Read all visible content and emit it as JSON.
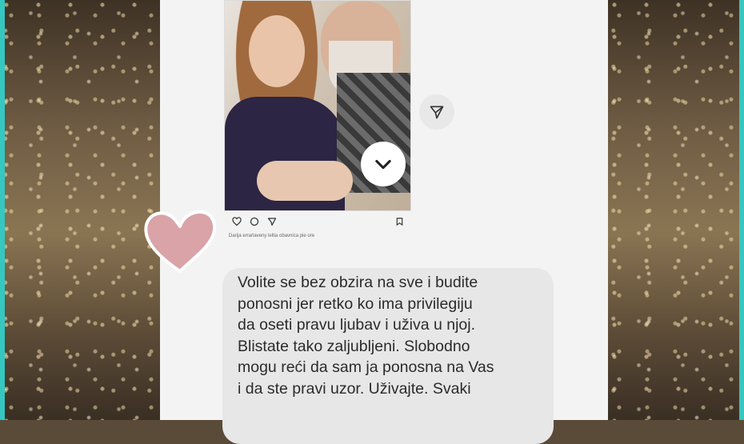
{
  "post": {
    "caption": "Darija errarlaveny leltia obavnica pie ore",
    "actions": [
      "like-icon",
      "comment-icon",
      "share-icon",
      "bookmark-icon"
    ]
  },
  "controls": {
    "expand_icon": "chevron-down-icon",
    "send_icon": "send-icon"
  },
  "decoration": {
    "heart_color": "#d9a3a7"
  },
  "message": {
    "text": "Volite se bez obzira na sve i budite\nponosni jer retko ko ima privilegiju\nda oseti pravu ljubav i uživa u njoj.\nBlistate tako zaljubljeni. Slobodno\nmogu reći da sam ja ponosna na Vas\ni da ste pravi uzor. Uživajte. Svaki"
  }
}
